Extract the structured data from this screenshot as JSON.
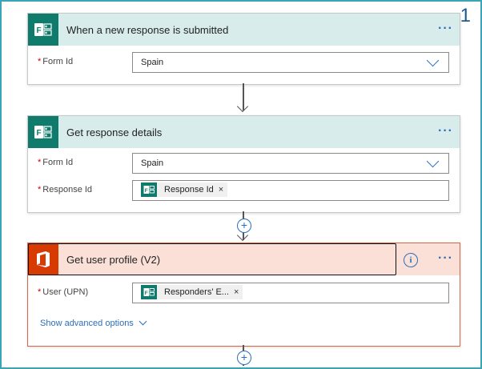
{
  "corner_number": "1",
  "cards": {
    "trigger": {
      "title": "When a new response is submitted",
      "more": "···",
      "form_id": {
        "label": "Form Id",
        "value": "Spain"
      }
    },
    "details": {
      "title": "Get response details",
      "more": "···",
      "form_id": {
        "label": "Form Id",
        "value": "Spain"
      },
      "response_id": {
        "label": "Response Id",
        "chip": "Response Id",
        "chip_remove": "×"
      }
    },
    "profile": {
      "title": "Get user profile (V2)",
      "more": "···",
      "info": "i",
      "user": {
        "label": "User (UPN)",
        "chip": "Responders' E...",
        "chip_remove": "×"
      },
      "advanced_label": "Show advanced options"
    }
  },
  "add_step": "+",
  "required_mark": "*",
  "colors": {
    "forms_green": "#0f7b6c",
    "office_orange": "#d83b01",
    "header_teal": "#d9ecec",
    "header_salmon": "#fbe0d8",
    "link_blue": "#2a6ebb",
    "frame_teal": "#3aa5b4"
  },
  "icons": {
    "forms": "forms-icon",
    "office": "office-icon",
    "more": "more-icon",
    "info": "info-icon",
    "chevron": "chevron-down-icon",
    "add": "plus-icon"
  }
}
